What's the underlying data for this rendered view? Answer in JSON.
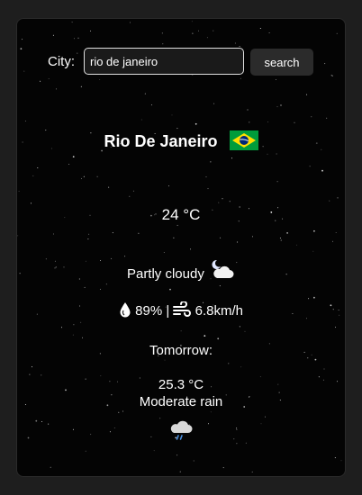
{
  "search": {
    "label": "City:",
    "value": "rio de janeiro",
    "button_label": "search"
  },
  "current": {
    "city": "Rio De Janeiro",
    "country_flag_icon": "brazil-flag-icon",
    "temperature": "24 °C",
    "condition": "Partly cloudy",
    "condition_icon": "partly-cloudy-night-icon",
    "humidity": "89%",
    "separator": "|",
    "wind": "6.8km/h"
  },
  "tomorrow": {
    "label": "Tomorrow:",
    "temperature": "25.3 °C",
    "condition": "Moderate rain",
    "condition_icon": "rain-cloud-icon"
  },
  "colors": {
    "background": "#040404",
    "text": "#ffffff",
    "button_bg": "#2b2b2b",
    "flag_green": "#009c3b",
    "flag_yellow": "#ffdf00",
    "flag_blue": "#002776"
  }
}
